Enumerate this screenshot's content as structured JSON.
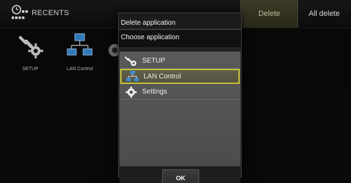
{
  "topbar": {
    "title": "RECENTS",
    "icon": "recents-clock-icon",
    "delete_label": "Delete",
    "all_delete_label": "All delete"
  },
  "recents": [
    {
      "label": "SETUP",
      "icon": "wrench-gear-icon"
    },
    {
      "label": "LAN Control",
      "icon": "network-icon"
    }
  ],
  "dialog": {
    "title": "Delete application",
    "subtitle": "Choose application",
    "items": [
      {
        "label": "SETUP",
        "icon": "wrench-gear-icon",
        "selected": false
      },
      {
        "label": "LAN Control",
        "icon": "network-icon",
        "selected": true
      },
      {
        "label": "Settings",
        "icon": "gear-icon",
        "selected": false
      }
    ],
    "ok_label": "OK"
  },
  "colors": {
    "accent_selection": "#c8c23a",
    "network_icon": "#3a8fd9"
  }
}
